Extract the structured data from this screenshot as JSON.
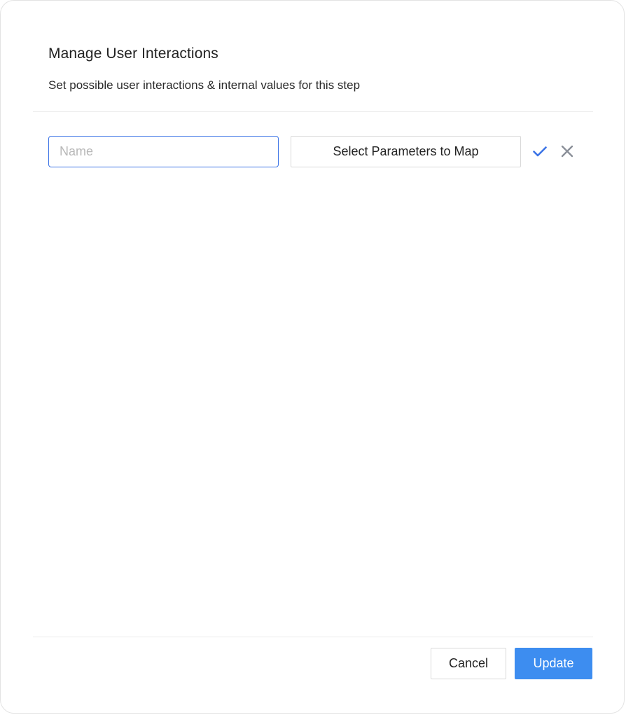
{
  "dialog": {
    "title": "Manage User Interactions",
    "subtitle": "Set possible user interactions & internal values for this step"
  },
  "form": {
    "name_placeholder": "Name",
    "name_value": "",
    "select_parameters_label": "Select Parameters to Map",
    "confirm_icon": "check-icon",
    "cancel_icon": "close-icon"
  },
  "footer": {
    "cancel_label": "Cancel",
    "update_label": "Update"
  },
  "colors": {
    "accent": "#3d8df0",
    "input_focus_border": "#3b73e6",
    "check_icon": "#3b73e6",
    "close_icon": "#8a8f98"
  }
}
